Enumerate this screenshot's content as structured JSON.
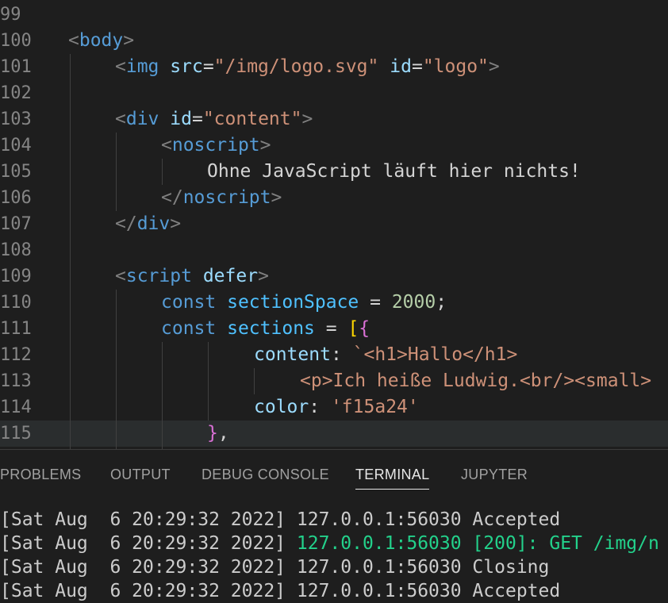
{
  "editor": {
    "lines": [
      {
        "n": "99"
      },
      {
        "n": "100",
        "parts": [
          [
            "br",
            "<"
          ],
          [
            "tag",
            "body"
          ],
          [
            "br",
            ">"
          ]
        ]
      },
      {
        "n": "101",
        "parts": [
          [
            "br",
            "<"
          ],
          [
            "tag",
            "img"
          ],
          [
            "txt",
            " "
          ],
          [
            "attr",
            "src"
          ],
          [
            "eq",
            "="
          ],
          [
            "str",
            "\"/img/logo.svg\""
          ],
          [
            "txt",
            " "
          ],
          [
            "attr",
            "id"
          ],
          [
            "eq",
            "="
          ],
          [
            "str",
            "\"logo\""
          ],
          [
            "br",
            ">"
          ]
        ]
      },
      {
        "n": "102"
      },
      {
        "n": "103",
        "parts": [
          [
            "br",
            "<"
          ],
          [
            "tag",
            "div"
          ],
          [
            "txt",
            " "
          ],
          [
            "attr",
            "id"
          ],
          [
            "eq",
            "="
          ],
          [
            "str",
            "\"content\""
          ],
          [
            "br",
            ">"
          ]
        ]
      },
      {
        "n": "104",
        "parts": [
          [
            "br",
            "<"
          ],
          [
            "tag",
            "noscript"
          ],
          [
            "br",
            ">"
          ]
        ]
      },
      {
        "n": "105",
        "parts": [
          [
            "txt",
            "Ohne JavaScript läuft hier nichts!"
          ]
        ]
      },
      {
        "n": "106",
        "parts": [
          [
            "br",
            "</"
          ],
          [
            "tag",
            "noscript"
          ],
          [
            "br",
            ">"
          ]
        ]
      },
      {
        "n": "107",
        "parts": [
          [
            "br",
            "</"
          ],
          [
            "tag",
            "div"
          ],
          [
            "br",
            ">"
          ]
        ]
      },
      {
        "n": "108"
      },
      {
        "n": "109",
        "parts": [
          [
            "br",
            "<"
          ],
          [
            "tag",
            "script"
          ],
          [
            "txt",
            " "
          ],
          [
            "attr",
            "defer"
          ],
          [
            "br",
            ">"
          ]
        ]
      },
      {
        "n": "110",
        "parts": [
          [
            "kw",
            "const"
          ],
          [
            "txt",
            " "
          ],
          [
            "var",
            "sectionSpace"
          ],
          [
            "txt",
            " = "
          ],
          [
            "num",
            "2000"
          ],
          [
            "txt",
            ";"
          ]
        ]
      },
      {
        "n": "111",
        "parts": [
          [
            "kw",
            "const"
          ],
          [
            "txt",
            " "
          ],
          [
            "var",
            "sections"
          ],
          [
            "txt",
            " = "
          ],
          [
            "bk1",
            "["
          ],
          [
            "bk2",
            "{"
          ]
        ]
      },
      {
        "n": "112",
        "parts": [
          [
            "prop",
            "content"
          ],
          [
            "txt",
            ": "
          ],
          [
            "tpl",
            "`<h1>Hallo</h1>"
          ]
        ]
      },
      {
        "n": "113",
        "parts": [
          [
            "tpl",
            "<p>Ich heiße Ludwig.<br/><small>"
          ]
        ]
      },
      {
        "n": "114",
        "parts": [
          [
            "prop",
            "color"
          ],
          [
            "txt",
            ": "
          ],
          [
            "str",
            "'f15a24'"
          ]
        ]
      },
      {
        "n": "115",
        "parts": [
          [
            "bk2",
            "}"
          ],
          [
            "txt",
            ","
          ]
        ]
      }
    ]
  },
  "panel": {
    "tabs": [
      "PROBLEMS",
      "OUTPUT",
      "DEBUG CONSOLE",
      "TERMINAL",
      "JUPYTER"
    ],
    "active_tab": "TERMINAL",
    "terminal": [
      {
        "prefix": "[Sat Aug  6 20:29:32 2022] ",
        "body": "127.0.0.1:56030 Accepted",
        "highlight": false
      },
      {
        "prefix": "[Sat Aug  6 20:29:32 2022] ",
        "body": "127.0.0.1:56030 [200]: GET /img/n",
        "highlight": true
      },
      {
        "prefix": "[Sat Aug  6 20:29:32 2022] ",
        "body": "127.0.0.1:56030 Closing",
        "highlight": false
      },
      {
        "prefix": "[Sat Aug  6 20:29:32 2022] ",
        "body": "127.0.0.1:56030 Accepted",
        "highlight": false
      }
    ]
  },
  "colors": {
    "background": "#1e1e1e",
    "terminal_green": "#23d18b",
    "line_number": "#858585"
  }
}
